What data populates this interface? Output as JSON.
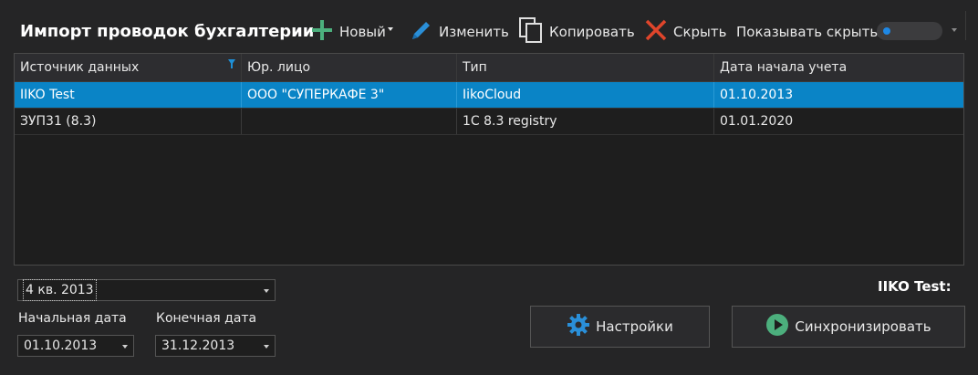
{
  "header": {
    "title": "Импорт проводок бухгалтерии",
    "new_label": "Новый",
    "edit_label": "Изменить",
    "copy_label": "Копировать",
    "hide_label": "Скрыть",
    "show_hidden_label": "Показывать скрытые"
  },
  "colors": {
    "accent": "#0a84c6",
    "add": "#4caf7d",
    "edit": "#2a8fd8",
    "delete": "#e0452b"
  },
  "grid": {
    "columns": [
      "Источник данных",
      "Юр. лицо",
      "Тип",
      "Дата начала учета"
    ],
    "rows": [
      [
        "IIKO Test",
        "ООО \"СУПЕРКАФЕ 3\"",
        "IikoCloud",
        "01.10.2013"
      ],
      [
        "ЗУП31 (8.3)",
        "",
        "1C 8.3 registry",
        "01.01.2020"
      ]
    ]
  },
  "period": {
    "value": "4 кв. 2013"
  },
  "start_date": {
    "label": "Начальная дата",
    "value": "01.10.2013"
  },
  "end_date": {
    "label": "Конечная дата",
    "value": "31.12.2013"
  },
  "entity_title": "IIKO Test:",
  "buttons": {
    "settings": "Настройки",
    "sync": "Синхронизировать"
  }
}
